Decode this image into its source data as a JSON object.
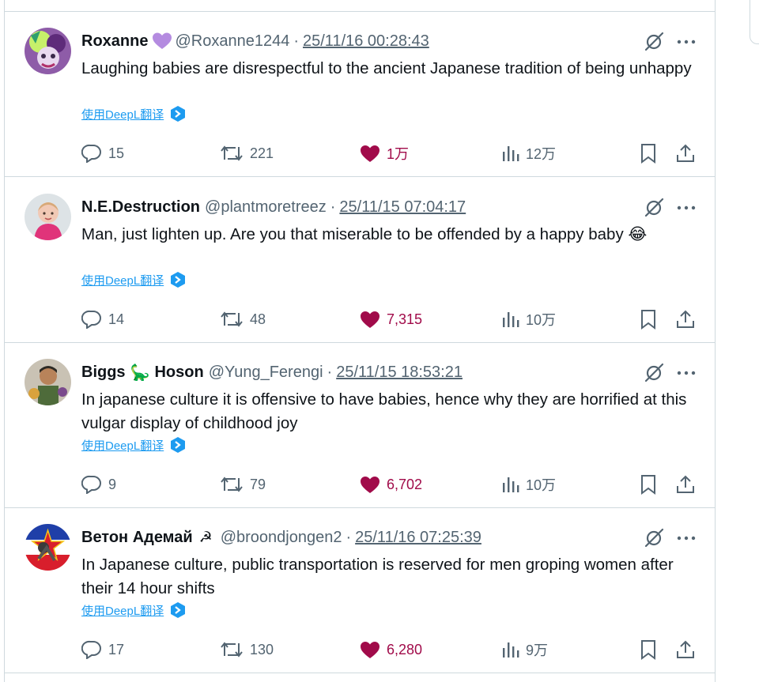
{
  "tweets": [
    {
      "name": "Roxanne",
      "badge": "purple-heart",
      "handle": "@Roxanne1244",
      "separator": "·",
      "time": "25/11/16 00:28:43",
      "text": "Laughing babies are disrespectful to the ancient Japanese tradition of being unhappy",
      "translate": "使用DeepL翻译",
      "replies": "15",
      "retweets": "221",
      "likes": "1万",
      "views": "12万"
    },
    {
      "name": "N.E.Destruction",
      "badge": "",
      "handle": "@plantmoretreez",
      "separator": "·",
      "time": "25/11/15 07:04:17",
      "text": "Man, just lighten up. Are you that miserable to be offended by a happy baby 😂",
      "translate": "使用DeepL翻译",
      "replies": "14",
      "retweets": "48",
      "likes": "7,315",
      "views": "10万"
    },
    {
      "name_part1": "Biggs",
      "name_emoji": "🦕",
      "name_part2": "Hoson",
      "handle": "@Yung_Ferengi",
      "separator": "·",
      "time": "25/11/15 18:53:21",
      "text": "In japanese culture it is offensive to have babies, hence why they are horrified at this vulgar display of childhood joy",
      "translate": "使用DeepL翻译",
      "replies": "9",
      "retweets": "79",
      "likes": "6,702",
      "views": "10万"
    },
    {
      "name": "Ветон Адемай",
      "name_emoji": "☭",
      "handle": "@broondjongen2",
      "separator": "·",
      "time": "25/11/16 07:25:39",
      "text": "In Japanese culture, public transportation is reserved for men groping women after their 14 hour shifts",
      "translate": "使用DeepL翻译",
      "replies": "17",
      "retweets": "130",
      "likes": "6,280",
      "views": "9万"
    }
  ],
  "colors": {
    "text": "#0f1419",
    "secondary": "#536471",
    "link": "#1d9bf0",
    "like": "#a10b4a",
    "border": "#cfd9de"
  },
  "icons": [
    "purple-heart-icon",
    "grok-icon",
    "more-icon",
    "deepl-icon",
    "reply-icon",
    "retweet-icon",
    "like-icon",
    "views-icon",
    "bookmark-icon",
    "share-icon"
  ]
}
